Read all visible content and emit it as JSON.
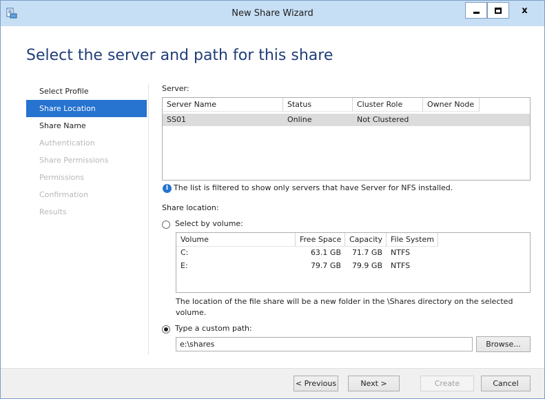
{
  "window": {
    "title": "New Share Wizard",
    "icon": "share-wizard-icon",
    "close_glyph": "x"
  },
  "page_title": "Select the server and path for this share",
  "nav": {
    "items": [
      {
        "label": "Select Profile",
        "state": "normal"
      },
      {
        "label": "Share Location",
        "state": "active"
      },
      {
        "label": "Share Name",
        "state": "normal"
      },
      {
        "label": "Authentication",
        "state": "disabled"
      },
      {
        "label": "Share Permissions",
        "state": "disabled"
      },
      {
        "label": "Permissions",
        "state": "disabled"
      },
      {
        "label": "Confirmation",
        "state": "disabled"
      },
      {
        "label": "Results",
        "state": "disabled"
      }
    ]
  },
  "server": {
    "label": "Server:",
    "columns": [
      "Server Name",
      "Status",
      "Cluster Role",
      "Owner Node"
    ],
    "rows": [
      {
        "name": "SS01",
        "status": "Online",
        "cluster_role": "Not Clustered",
        "owner_node": ""
      }
    ],
    "info_text": "The list is filtered to show only servers that have Server for NFS installed."
  },
  "share_location": {
    "label": "Share location:",
    "by_volume_label": "Select by volume:",
    "by_volume_selected": false,
    "volume_columns": [
      "Volume",
      "Free Space",
      "Capacity",
      "File System"
    ],
    "volumes": [
      {
        "volume": "C:",
        "free": "63.1 GB",
        "capacity": "71.7 GB",
        "fs": "NTFS"
      },
      {
        "volume": "E:",
        "free": "79.7 GB",
        "capacity": "79.9 GB",
        "fs": "NTFS"
      }
    ],
    "volume_note_line1": "The location of the file share will be a new folder in the \\Shares directory on the selected",
    "volume_note_line2": "volume.",
    "custom_path_label": "Type a custom path:",
    "custom_path_selected": true,
    "custom_path_value": "e:\\shares",
    "browse_label": "Browse..."
  },
  "footer": {
    "previous": "< Previous",
    "next": "Next >",
    "create": "Create",
    "cancel": "Cancel"
  },
  "colors": {
    "accent": "#2673d0",
    "titlebar": "#c7dff5",
    "page_title": "#1f3d77"
  }
}
